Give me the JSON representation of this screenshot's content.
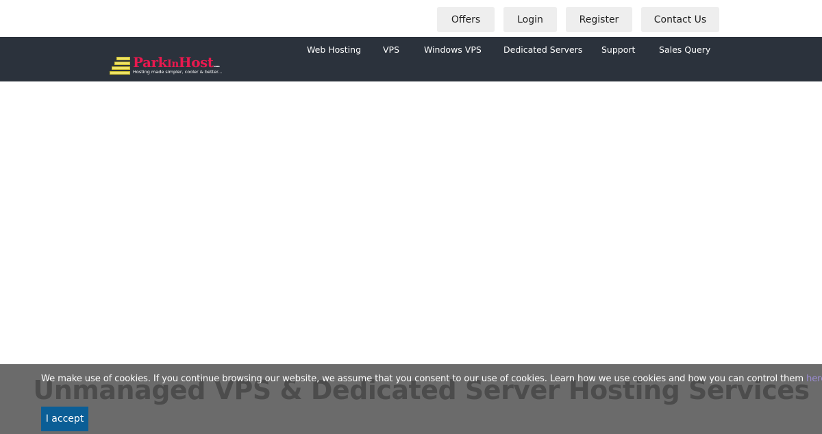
{
  "top_links": {
    "offers": "Offers",
    "login": "Login",
    "register": "Register",
    "contact": "Contact Us"
  },
  "logo": {
    "name_part1": "Park",
    "name_part2": "In",
    "name_part3": "Host",
    "suffix": ".com",
    "tagline": "Hosting made simpler, cooler & better..."
  },
  "nav": {
    "items": [
      {
        "label": "Web Hosting"
      },
      {
        "label": "VPS"
      },
      {
        "label": "Windows VPS"
      },
      {
        "label": "Dedicated Servers"
      },
      {
        "label": "Support"
      },
      {
        "label": "Sales Query"
      }
    ]
  },
  "hero": {
    "title": "Unmanaged VPS & Dedicated Server Hosting Services"
  },
  "cookie_banner": {
    "message": "We make use of cookies. If you continue browsing our website, we assume that you consent to our use of cookies. Learn how we use cookies and how you can control them ",
    "link_label": "here",
    "accept_label": "I accept"
  },
  "colors": {
    "navbar_bg": "#2b323c",
    "logo_accent": "#e8194f",
    "accept_button": "#0b5e96",
    "link": "#9b8cd3"
  }
}
